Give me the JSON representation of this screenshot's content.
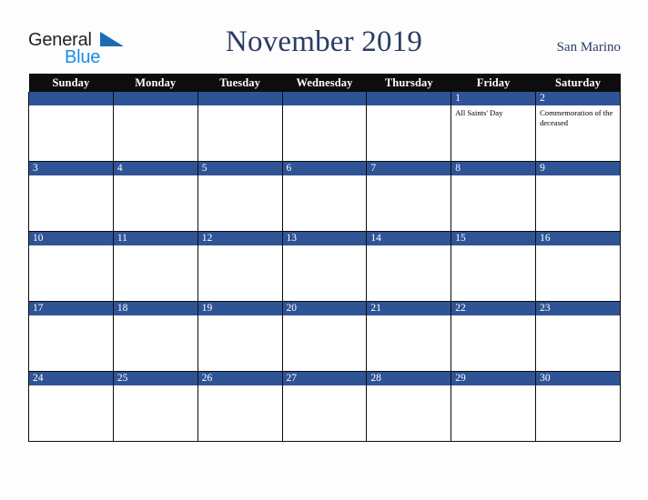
{
  "brand": {
    "name_part1": "General",
    "name_part2": "Blue",
    "triangle_icon": "triangle-icon",
    "color_dark": "#231f20",
    "color_blue": "#1b8ce3",
    "color_triangle": "#1b6cb5"
  },
  "header": {
    "title": "November 2019",
    "location": "San Marino",
    "title_color": "#2b3c63"
  },
  "calendar": {
    "weekday_headers": [
      "Sunday",
      "Monday",
      "Tuesday",
      "Wednesday",
      "Thursday",
      "Friday",
      "Saturday"
    ],
    "header_bg": "#0d0d0d",
    "daynum_bg": "#2f5496",
    "cell_bg": "#ffffff",
    "weeks": [
      [
        {
          "day": "",
          "event": ""
        },
        {
          "day": "",
          "event": ""
        },
        {
          "day": "",
          "event": ""
        },
        {
          "day": "",
          "event": ""
        },
        {
          "day": "",
          "event": ""
        },
        {
          "day": "1",
          "event": "All Saints' Day"
        },
        {
          "day": "2",
          "event": "Commemoration of the deceased"
        }
      ],
      [
        {
          "day": "3",
          "event": ""
        },
        {
          "day": "4",
          "event": ""
        },
        {
          "day": "5",
          "event": ""
        },
        {
          "day": "6",
          "event": ""
        },
        {
          "day": "7",
          "event": ""
        },
        {
          "day": "8",
          "event": ""
        },
        {
          "day": "9",
          "event": ""
        }
      ],
      [
        {
          "day": "10",
          "event": ""
        },
        {
          "day": "11",
          "event": ""
        },
        {
          "day": "12",
          "event": ""
        },
        {
          "day": "13",
          "event": ""
        },
        {
          "day": "14",
          "event": ""
        },
        {
          "day": "15",
          "event": ""
        },
        {
          "day": "16",
          "event": ""
        }
      ],
      [
        {
          "day": "17",
          "event": ""
        },
        {
          "day": "18",
          "event": ""
        },
        {
          "day": "19",
          "event": ""
        },
        {
          "day": "20",
          "event": ""
        },
        {
          "day": "21",
          "event": ""
        },
        {
          "day": "22",
          "event": ""
        },
        {
          "day": "23",
          "event": ""
        }
      ],
      [
        {
          "day": "24",
          "event": ""
        },
        {
          "day": "25",
          "event": ""
        },
        {
          "day": "26",
          "event": ""
        },
        {
          "day": "27",
          "event": ""
        },
        {
          "day": "28",
          "event": ""
        },
        {
          "day": "29",
          "event": ""
        },
        {
          "day": "30",
          "event": ""
        }
      ]
    ]
  }
}
